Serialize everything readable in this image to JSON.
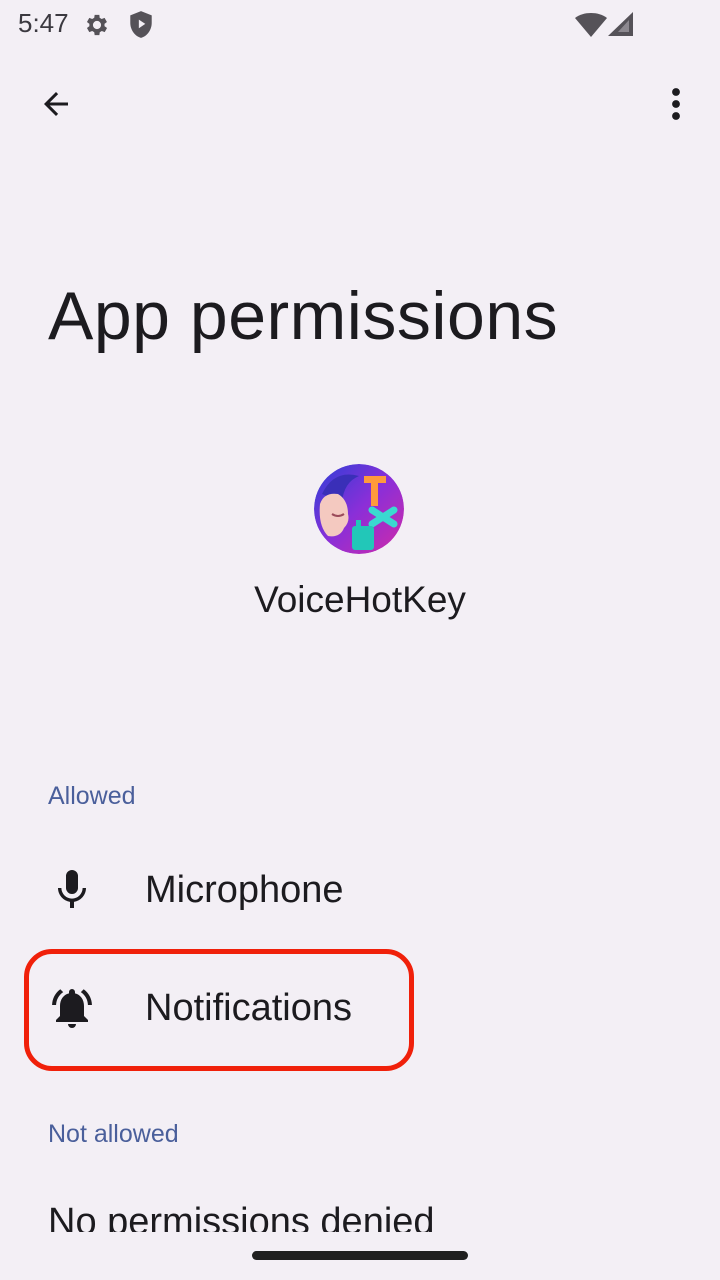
{
  "status_bar": {
    "time": "5:47",
    "left_icons": [
      "gear-icon",
      "shield-icon"
    ],
    "right_icons": [
      "wifi-icon",
      "cell-signal-icon"
    ]
  },
  "top_bar": {
    "back_icon": "arrow-left-icon",
    "menu_icon": "more-vertical-icon"
  },
  "page": {
    "title": "App permissions"
  },
  "app": {
    "name": "VoiceHotKey",
    "icon": "voicehotkey-app-icon"
  },
  "sections": {
    "allowed": {
      "header": "Allowed",
      "items": [
        {
          "label": "Microphone",
          "icon": "microphone-icon"
        },
        {
          "label": "Notifications",
          "icon": "bell-ringing-icon"
        }
      ]
    },
    "not_allowed": {
      "header": "Not allowed",
      "empty_text": "No permissions denied"
    }
  },
  "colors": {
    "background": "#f3eff5",
    "section_header": "#4a5f9b",
    "highlight": "#f0200a"
  }
}
